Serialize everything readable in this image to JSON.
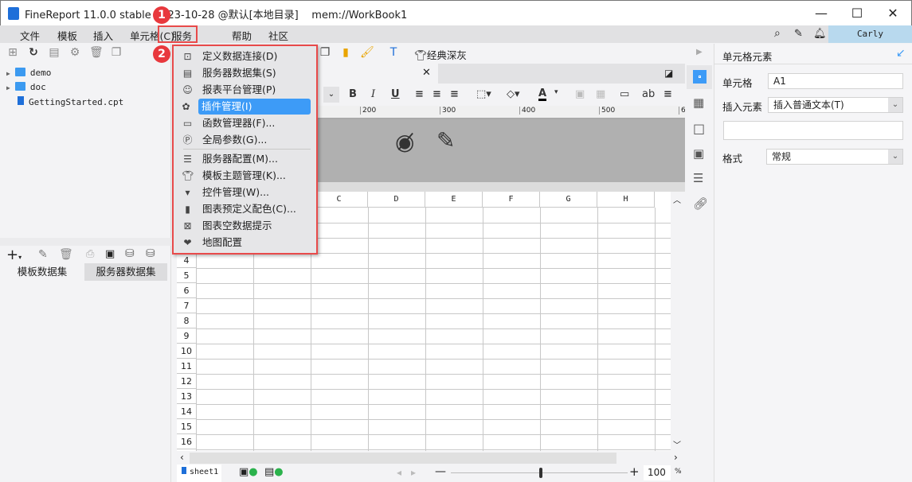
{
  "window": {
    "title": "FineReport 11.0.0 stable 2023-10-28 @默认[本地目录]",
    "doc": "mem://WorkBook1"
  },
  "menu": [
    "文件",
    "模板",
    "插入",
    "单元格(C)",
    "服务器",
    "帮助",
    "社区"
  ],
  "user": "Carly",
  "tree": [
    "demo",
    "doc",
    "GettingStarted.cpt"
  ],
  "dataset_tabs": [
    "模板数据集",
    "服务器数据集"
  ],
  "server_menu": [
    {
      "icon": "data-connection-icon",
      "label": "定义数据连接(D)"
    },
    {
      "icon": "server-dataset-icon",
      "label": "服务器数据集(S)"
    },
    {
      "icon": "user-icon",
      "label": "报表平台管理(P)"
    },
    {
      "icon": "plugin-icon",
      "label": "插件管理(I)",
      "selected": true
    },
    {
      "icon": "function-icon",
      "label": "函数管理器(F)..."
    },
    {
      "icon": "parameter-icon",
      "label": "全局参数(G)..."
    },
    {
      "icon": "server-config-icon",
      "label": "服务器配置(M)..."
    },
    {
      "icon": "theme-icon",
      "label": "模板主题管理(K)..."
    },
    {
      "icon": "widget-icon",
      "label": "控件管理(W)..."
    },
    {
      "icon": "bar-chart-icon",
      "label": "图表预定义配色(C)..."
    },
    {
      "icon": "chart-empty-icon",
      "label": "图表空数据提示"
    },
    {
      "icon": "map-icon",
      "label": "地图配置"
    }
  ],
  "annotations": [
    "1",
    "2"
  ],
  "toolbar": {
    "theme": "经典深灰"
  },
  "ruler": [
    "200",
    "300",
    "400",
    "500",
    "6"
  ],
  "columns": [
    "C",
    "D",
    "E",
    "F",
    "G",
    "H"
  ],
  "rows": [
    "4",
    "5",
    "6",
    "7",
    "8",
    "9",
    "10",
    "11",
    "12",
    "13",
    "14",
    "15",
    "16"
  ],
  "sheet": "sheet1",
  "zoom": {
    "value": "100",
    "unit": "%",
    "level": 0.5
  },
  "props": {
    "title": "单元格元素",
    "cell_label": "单元格",
    "cell_value": "A1",
    "insert_label": "插入元素",
    "insert_value": "插入普通文本(T)",
    "format_label": "格式",
    "format_value": "常规"
  },
  "colors": {
    "accent": "#3d9bf7",
    "highlight": "#e84a4a",
    "user_bg": "#b8d9ee"
  }
}
